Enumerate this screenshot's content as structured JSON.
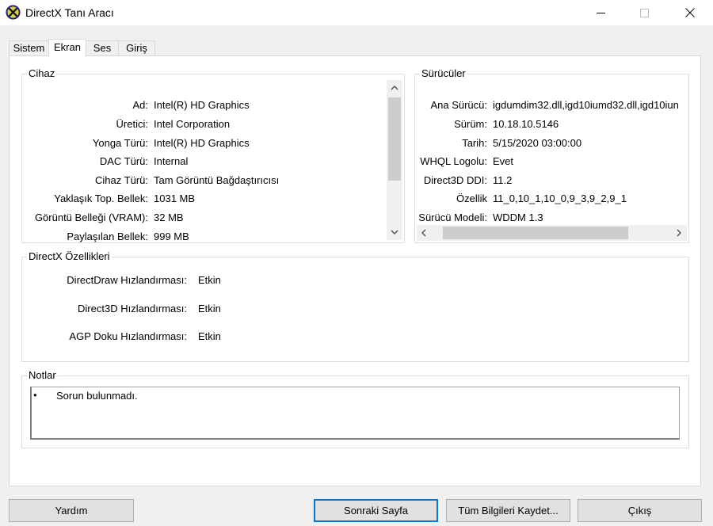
{
  "window": {
    "title": "DirectX Tanı Aracı"
  },
  "tabs": [
    {
      "label": "Sistem"
    },
    {
      "label": "Ekran"
    },
    {
      "label": "Ses"
    },
    {
      "label": "Giriş"
    }
  ],
  "device": {
    "title": "Cihaz",
    "rows": [
      {
        "label": "Ad:",
        "value": "Intel(R) HD Graphics"
      },
      {
        "label": "Üretici:",
        "value": "Intel Corporation"
      },
      {
        "label": "Yonga Türü:",
        "value": "Intel(R) HD Graphics"
      },
      {
        "label": "DAC Türü:",
        "value": "Internal"
      },
      {
        "label": "Cihaz Türü:",
        "value": "Tam Görüntü Bağdaştırıcısı"
      },
      {
        "label": "Yaklaşık Top. Bellek:",
        "value": "1031 MB"
      },
      {
        "label": "Görüntü Belleği (VRAM):",
        "value": "32 MB"
      },
      {
        "label": "Paylaşılan Bellek:",
        "value": "999 MB"
      }
    ]
  },
  "drivers": {
    "title": "Sürücüler",
    "rows": [
      {
        "label": "Ana Sürücü:",
        "value": "igdumdim32.dll,igd10iumd32.dll,igd10iun"
      },
      {
        "label": "Sürüm:",
        "value": "10.18.10.5146"
      },
      {
        "label": "Tarih:",
        "value": "5/15/2020 03:00:00"
      },
      {
        "label": "WHQL Logolu:",
        "value": "Evet"
      },
      {
        "label": "Direct3D DDI:",
        "value": "11.2"
      },
      {
        "label": "Özellik",
        "value": "11_0,10_1,10_0,9_3,9_2,9_1"
      },
      {
        "label": "Sürücü Modeli:",
        "value": "WDDM 1.3"
      }
    ]
  },
  "features": {
    "title": "DirectX Özellikleri",
    "rows": [
      {
        "label": "DirectDraw Hızlandırması:",
        "value": "Etkin"
      },
      {
        "label": "Direct3D Hızlandırması:",
        "value": "Etkin"
      },
      {
        "label": "AGP Doku Hızlandırması:",
        "value": "Etkin"
      }
    ]
  },
  "notes": {
    "title": "Notlar",
    "bullet": "•",
    "items": [
      "Sorun bulunmadı."
    ]
  },
  "buttons": {
    "help": "Yardım",
    "next": "Sonraki Sayfa",
    "save_all": "Tüm Bilgileri Kaydet...",
    "exit": "Çıkış"
  },
  "icons": {
    "app": "directx-icon",
    "minimize": "minimize-icon",
    "maximize": "maximize-icon",
    "close": "close-icon",
    "scroll_up": "chevron-up-icon",
    "scroll_down": "chevron-down-icon",
    "scroll_left": "chevron-left-icon",
    "scroll_right": "chevron-right-icon"
  },
  "colors": {
    "accent": "#0078d7",
    "panel": "#ffffff",
    "chrome": "#f0f0f0",
    "app_icon": "#1a1a7a"
  }
}
